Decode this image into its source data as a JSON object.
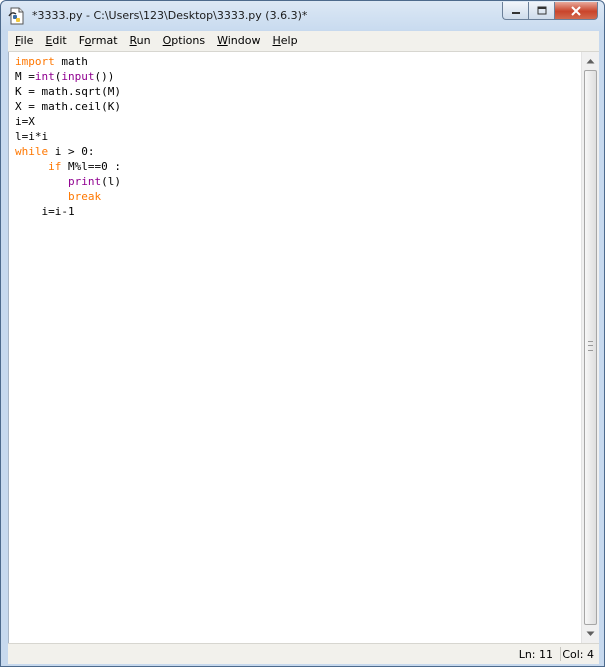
{
  "window": {
    "title": "*3333.py - C:\\Users\\123\\Desktop\\3333.py (3.6.3)*",
    "app_icon": "python-idle-file-icon",
    "minimize_icon": "minimize-icon",
    "maximize_icon": "maximize-icon",
    "close_icon": "close-icon"
  },
  "menu": {
    "items": [
      {
        "label": "File",
        "mnemonic": "F",
        "rest": "ile"
      },
      {
        "label": "Edit",
        "mnemonic": "E",
        "rest": "dit"
      },
      {
        "label": "Format",
        "mnemonic": "o",
        "before": "F",
        "rest": "rmat"
      },
      {
        "label": "Run",
        "mnemonic": "R",
        "rest": "un"
      },
      {
        "label": "Options",
        "mnemonic": "O",
        "rest": "ptions"
      },
      {
        "label": "Window",
        "mnemonic": "W",
        "rest": "indow"
      },
      {
        "label": "Help",
        "mnemonic": "H",
        "rest": "elp"
      }
    ]
  },
  "editor": {
    "lines": [
      {
        "tokens": [
          {
            "t": "import",
            "c": "kw"
          },
          {
            "t": " math",
            "c": ""
          }
        ]
      },
      {
        "tokens": [
          {
            "t": "M =",
            "c": ""
          },
          {
            "t": "int",
            "c": "bi"
          },
          {
            "t": "(",
            "c": ""
          },
          {
            "t": "input",
            "c": "bi"
          },
          {
            "t": "())",
            "c": ""
          }
        ]
      },
      {
        "tokens": [
          {
            "t": "K = math.sqrt(M)",
            "c": ""
          }
        ]
      },
      {
        "tokens": [
          {
            "t": "X = math.ceil(K)",
            "c": ""
          }
        ]
      },
      {
        "tokens": [
          {
            "t": "i=X",
            "c": ""
          }
        ]
      },
      {
        "tokens": [
          {
            "t": "l=i*i",
            "c": ""
          }
        ]
      },
      {
        "tokens": [
          {
            "t": "while",
            "c": "kw"
          },
          {
            "t": " i > 0:",
            "c": ""
          }
        ]
      },
      {
        "tokens": [
          {
            "t": "     ",
            "c": ""
          },
          {
            "t": "if",
            "c": "kw"
          },
          {
            "t": " M%l==0 :",
            "c": ""
          }
        ]
      },
      {
        "tokens": [
          {
            "t": "        ",
            "c": ""
          },
          {
            "t": "print",
            "c": "bi"
          },
          {
            "t": "(l)",
            "c": ""
          }
        ]
      },
      {
        "tokens": [
          {
            "t": "        ",
            "c": ""
          },
          {
            "t": "break",
            "c": "kw"
          }
        ]
      },
      {
        "tokens": [
          {
            "t": "    i=i-1",
            "c": ""
          }
        ]
      }
    ]
  },
  "scrollbar": {
    "up_icon": "scroll-up-arrow-icon",
    "down_icon": "scroll-down-arrow-icon"
  },
  "status": {
    "line": "Ln: 11",
    "col": "Col: 4"
  },
  "colors": {
    "keyword": "#ff7700",
    "builtin": "#900090",
    "text": "#000000"
  }
}
